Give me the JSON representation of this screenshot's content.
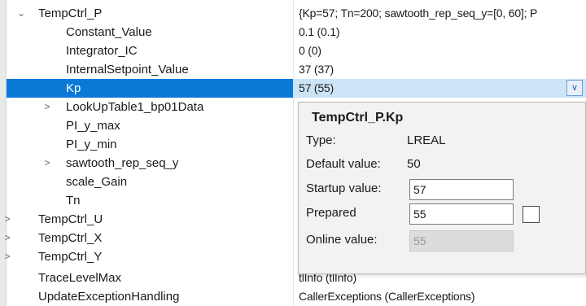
{
  "rows": [
    {
      "name": "TempCtrl_P",
      "value": "{Kp=57; Tn=200; sawtooth_rep_seq_y=[0, 60]; P",
      "toggle": "⌄"
    },
    {
      "name": "Constant_Value",
      "value": "0.1 (0.1)"
    },
    {
      "name": "Integrator_IC",
      "value": "0 (0)"
    },
    {
      "name": "InternalSetpoint_Value",
      "value": "37 (37)"
    },
    {
      "name": "Kp",
      "value": "57 (55)"
    },
    {
      "name": "LookUpTable1_bp01Data",
      "value": "",
      "toggle": ">"
    },
    {
      "name": "PI_y_max",
      "value": ""
    },
    {
      "name": "PI_y_min",
      "value": ""
    },
    {
      "name": "sawtooth_rep_seq_y",
      "value": "",
      "toggle": ">"
    },
    {
      "name": "scale_Gain",
      "value": ""
    },
    {
      "name": "Tn",
      "value": ""
    },
    {
      "name": "TempCtrl_U",
      "value": "",
      "toggle": ">"
    },
    {
      "name": "TempCtrl_X",
      "value": "",
      "toggle": ">"
    },
    {
      "name": "TempCtrl_Y",
      "value": "",
      "toggle": ">"
    },
    {
      "name": "TraceLevelMax",
      "value": "tlInfo (tlInfo)"
    },
    {
      "name": "UpdateExceptionHandling",
      "value": "CallerExceptions (CallerExceptions)"
    }
  ],
  "dropdown_icon": "chevron-down-icon",
  "popup": {
    "title": "TempCtrl_P.Kp",
    "type_label": "Type:",
    "type_value": "LREAL",
    "default_label": "Default value:",
    "default_value": "50",
    "startup_label": "Startup value:",
    "startup_value": "57",
    "prepared_label": "Prepared",
    "prepared_value": "55",
    "online_label": "Online value:",
    "online_value": "55"
  },
  "colors": {
    "selected_name_bg": "#0a78d7",
    "selected_value_bg": "#cce4f7"
  }
}
